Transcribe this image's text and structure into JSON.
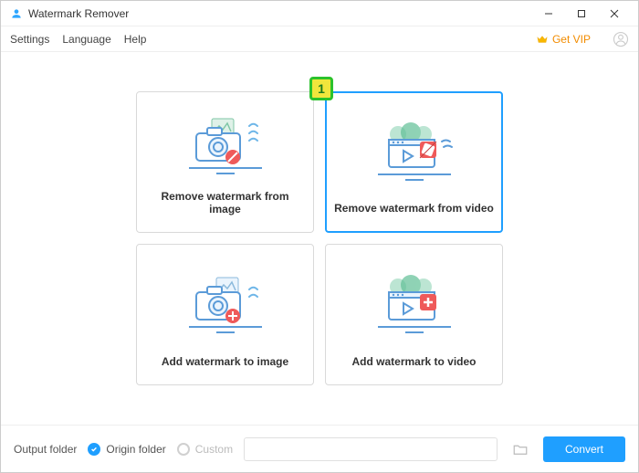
{
  "titlebar": {
    "app_name": "Watermark Remover"
  },
  "menu": {
    "settings": "Settings",
    "language": "Language",
    "help": "Help",
    "get_vip": "Get VIP"
  },
  "cards": {
    "remove_image": "Remove watermark from image",
    "remove_video": "Remove watermark from video",
    "add_image": "Add watermark to image",
    "add_video": "Add watermark to video"
  },
  "callout": {
    "label": "1"
  },
  "bottom": {
    "output_folder_label": "Output folder",
    "origin_label": "Origin folder",
    "custom_label": "Custom",
    "path_value": "",
    "convert_label": "Convert"
  }
}
